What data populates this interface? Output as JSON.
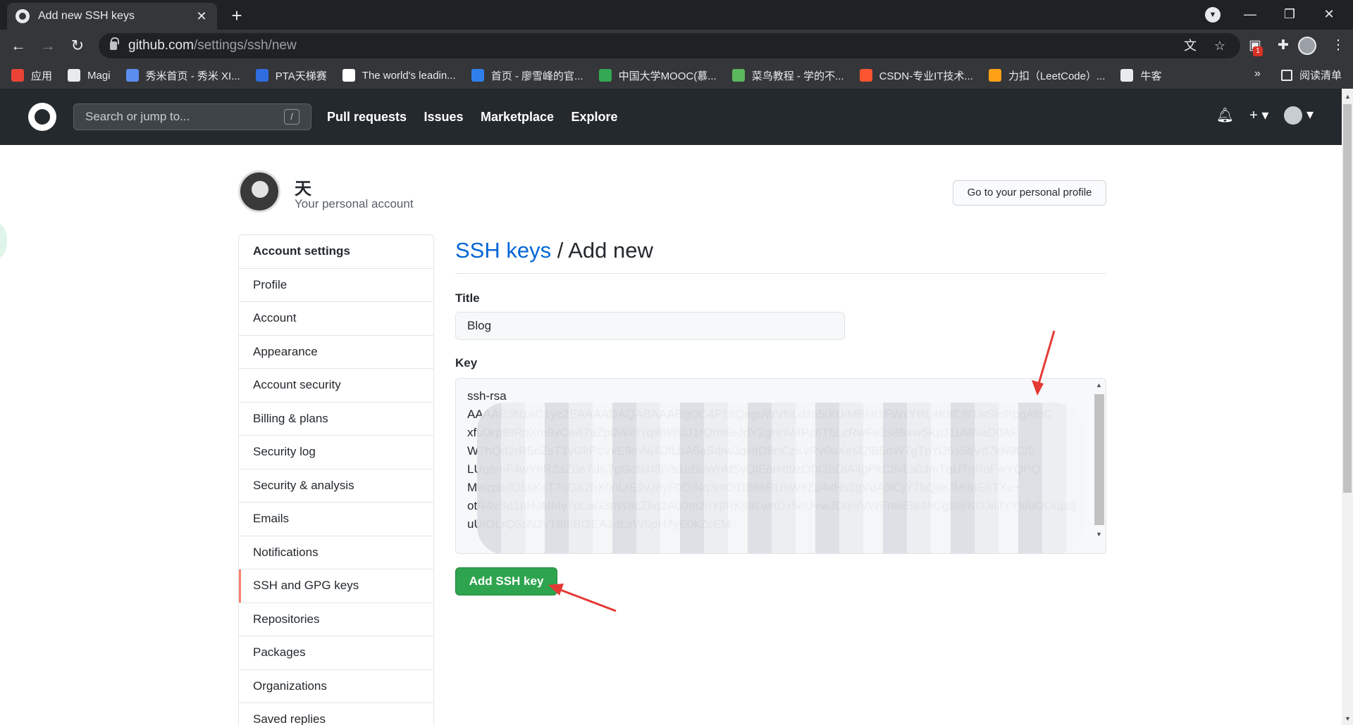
{
  "browser": {
    "tab_title": "Add new SSH keys",
    "url_host": "github.com",
    "url_path": "/settings/ssh/new",
    "badge_count": "1"
  },
  "bookmarks": [
    {
      "label": "应用",
      "color": "#ea4335"
    },
    {
      "label": "Magi",
      "color": "#e8eaed"
    },
    {
      "label": "秀米首页 - 秀米 XI...",
      "color": "#5b8def"
    },
    {
      "label": "PTA天梯赛",
      "color": "#2f6de1"
    },
    {
      "label": "The world's leadin...",
      "color": "#ffffff"
    },
    {
      "label": "首页 - 廖雪峰的官...",
      "color": "#2f80ed"
    },
    {
      "label": "中国大学MOOC(慕...",
      "color": "#34a853"
    },
    {
      "label": "菜鸟教程 - 学的不...",
      "color": "#5cb85c"
    },
    {
      "label": "CSDN-专业IT技术...",
      "color": "#fc5531"
    },
    {
      "label": "力扣（LeetCode）...",
      "color": "#ffa116"
    },
    {
      "label": "牛客",
      "color": "#e8eaed"
    }
  ],
  "bookmarks_more": "»",
  "reading_list": "阅读清单",
  "gh": {
    "search_placeholder": "Search or jump to...",
    "search_key": "/",
    "nav": [
      "Pull requests",
      "Issues",
      "Marketplace",
      "Explore"
    ]
  },
  "account": {
    "name": "天",
    "subtitle": "Your personal account",
    "profile_button": "Go to your personal profile"
  },
  "sidebar": {
    "items": [
      "Account settings",
      "Profile",
      "Account",
      "Appearance",
      "Account security",
      "Billing & plans",
      "Security log",
      "Security & analysis",
      "Emails",
      "Notifications",
      "SSH and GPG keys",
      "Repositories",
      "Packages",
      "Organizations",
      "Saved replies"
    ],
    "selected": "SSH and GPG keys"
  },
  "main": {
    "heading_link": "SSH keys",
    "heading_rest": " / Add new",
    "title_label": "Title",
    "title_value": "Blog",
    "key_label": "Key",
    "key_lines": [
      "ssh-rsa",
      "AAAAB3NzaC1yc2EAAAADAQABAAABgQC4F18QnguWVNLdza5iXU/MBHI1FWxYRL4K8Cjt/1wSIoPbgAfoC",
      "xfu0kpBIRqXm9vCeA7aZp0WXtYq9hWsU1rQmKeJdY2gHnV4Pz6TbLcRwFe3s8Bxw5KpJ1uMNaD0AF",
      "W7hQd2rR5oZsT1yGkPcVxE9mNj4UfLbA6aSdIw3qHtO8nCzKyRv0uXeM2lB5oW7gTpYiJ6s5bVd7kN9C/2",
      "LUq8mF4wYhR2aZ0eTdK7pGcNxI3jVs1oBuWnM5yQlE6rHt9zOfX2bDiA4gPkC8vLs0JmTqU7nRoFwYQPQ",
      "MwzpbIfD5sKcT7uGa2hX0nLrE9vJ8yF0D/Nq3mO1tB6kRUIiWeZp4xHs2gVdA5lCjY7bQoKfM9uEnTXu+",
      "otR4vSd1bHJMhIy7pLaG3nW8cZkq2Ao0m2nYjtRKs9LwnDx5eU+wJDqe/VWFnwEte4hCgB6rKOJiIJYYk/uOOupdj",
      "uU/OLrQ5sN2vT8mBf3EA1dLxW6pH7yE0kZcEM"
    ],
    "submit": "Add SSH key"
  }
}
